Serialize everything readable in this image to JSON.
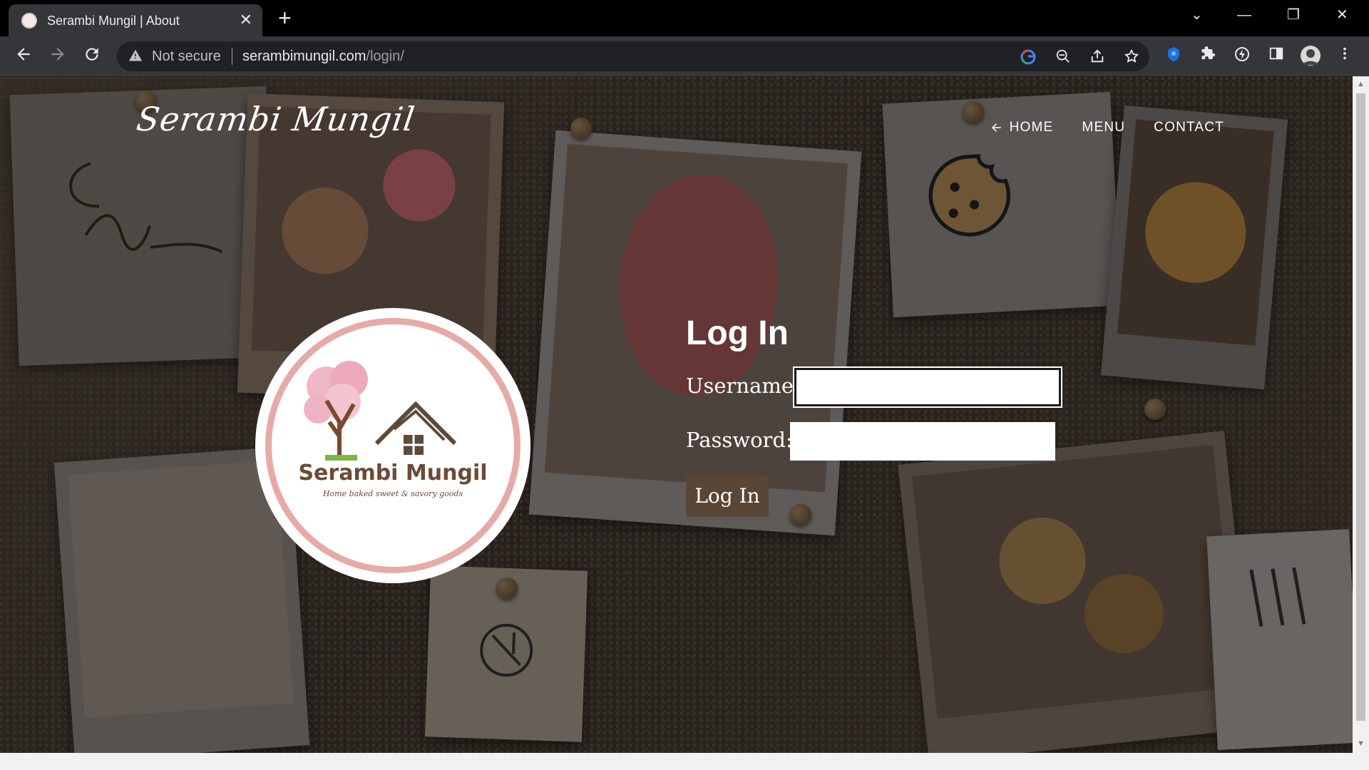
{
  "browser": {
    "tab_title": "Serambi Mungil | About",
    "tab_close": "✕",
    "new_tab": "+",
    "window_controls": {
      "tabs_menu": "⌄",
      "minimize": "—",
      "restore": "❐",
      "close": "✕"
    },
    "security_label": "Not secure",
    "url_host": "serambimungil.com",
    "url_path": "/login/",
    "icons": {
      "back": "back-arrow-icon",
      "forward": "forward-arrow-icon",
      "reload": "reload-icon",
      "google": "google-icon",
      "zoom": "zoom-out-icon",
      "share": "share-icon",
      "bookmark": "star-icon",
      "extension_blue": "extension-icon",
      "extensions": "puzzle-icon",
      "performance": "performance-icon",
      "sidepanel": "side-panel-icon",
      "profile": "avatar",
      "menu": "kebab-menu-icon"
    }
  },
  "site": {
    "brand": "Serambi Mungil",
    "nav": [
      {
        "label": "HOME",
        "icon": "arrow-left-icon"
      },
      {
        "label": "MENU"
      },
      {
        "label": "CONTACT"
      }
    ],
    "logo": {
      "name": "Serambi Mungil",
      "tagline": "Home baked sweet & savory goods"
    },
    "login": {
      "title": "Log In",
      "username_label": "Username:",
      "username_value": "",
      "password_label": "Password:",
      "password_value": "",
      "submit_label": "Log In"
    }
  },
  "colors": {
    "button_bg": "#5a4637",
    "logo_ring": "#e6aaa8",
    "logo_text": "#6b4a36",
    "tree_blossom": "#f0b7c6"
  }
}
